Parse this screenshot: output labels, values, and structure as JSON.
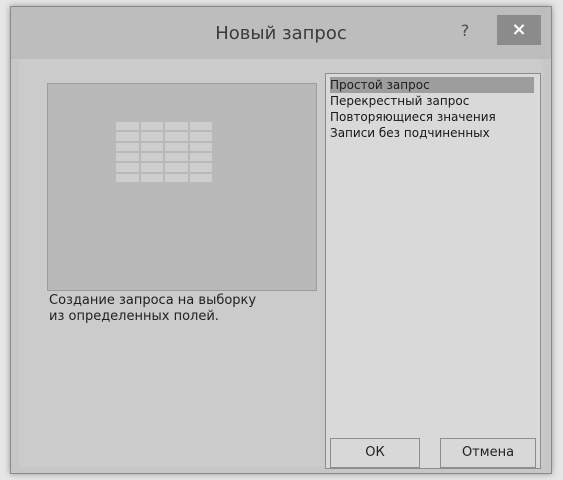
{
  "window": {
    "title": "Новый запрос",
    "help_label": "?",
    "close_label": "×"
  },
  "dialog": {
    "description_line1": "Создание запроса на выборку",
    "description_line2": "из определенных полей.",
    "list_items": [
      "Простой запрос",
      "Перекрестный запрос",
      "Повторяющиеся значения",
      "Записи без подчиненных"
    ],
    "selected_item": "Простой запрос"
  },
  "buttons": {
    "ok_label": "ОК",
    "cancel_label": "Отмена"
  },
  "colors": {
    "window_bg": "#c7c7c7",
    "titlebar": "#bdbdbd",
    "close_button": "#8b8b8b",
    "selection": "#9d9d9d",
    "panel": "#b9b9b9"
  }
}
